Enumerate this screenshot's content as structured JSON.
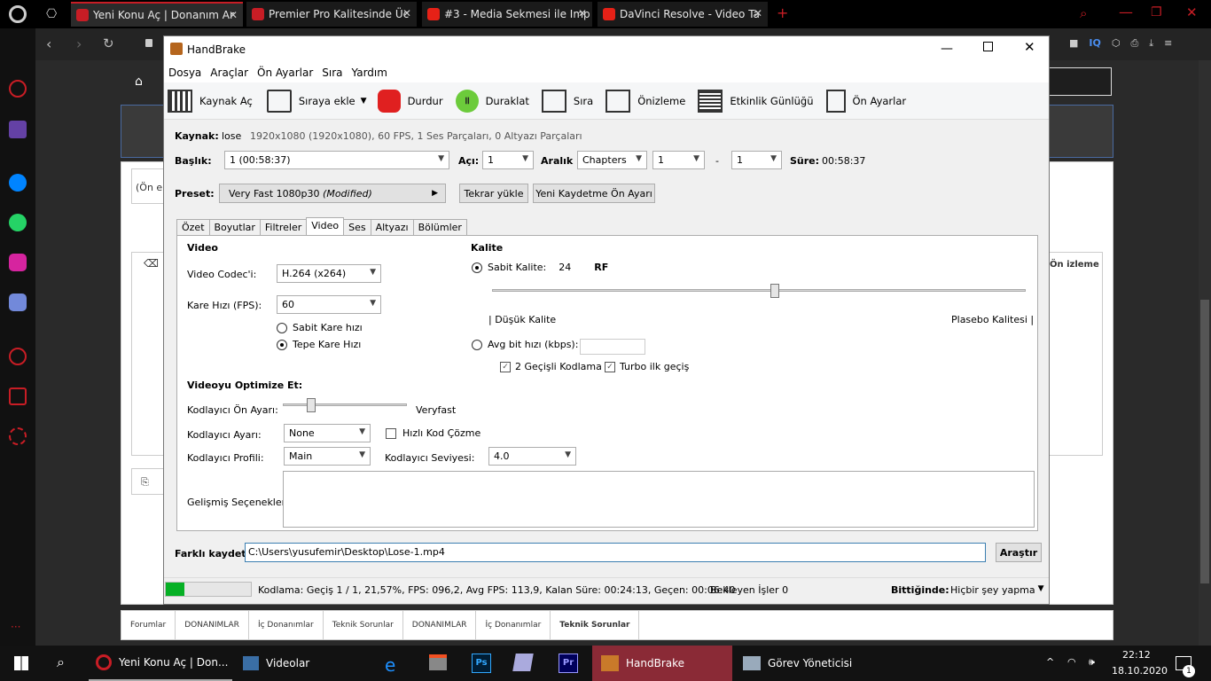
{
  "browser": {
    "tabs": [
      {
        "label": "Yeni Konu Aç | Donanım Ar",
        "active": true
      },
      {
        "label": "Premier Pro Kalitesinde Üc",
        "active": false
      },
      {
        "label": "#3 - Media Sekmesi ile Imp",
        "active": false
      },
      {
        "label": "DaVinci Resolve - Video Ta",
        "active": false
      }
    ]
  },
  "site": {
    "filter_text": "(Ön el",
    "preview_label": "Ön izleme",
    "breadcrumb": [
      "Forumlar",
      "DONANIMLAR",
      "İç Donanımlar",
      "Teknik Sorunlar",
      "DONANIMLAR",
      "İç Donanımlar",
      "Teknik Sorunlar"
    ]
  },
  "app": {
    "title": "HandBrake",
    "menu": [
      "Dosya",
      "Araçlar",
      "Ön Ayarlar",
      "Sıra",
      "Yardım"
    ],
    "toolbar": {
      "source": "Kaynak Aç",
      "add_queue": "Sıraya ekle",
      "stop": "Durdur",
      "pause": "Duraklat",
      "queue": "Sıra",
      "preview": "Önizleme",
      "activity": "Etkinlik Günlüğü",
      "presets": "Ön Ayarlar"
    },
    "source": {
      "label": "Kaynak:",
      "name": "lose",
      "info": "1920x1080 (1920x1080), 60 FPS, 1 Ses Parçaları, 0 Altyazı Parçaları"
    },
    "title_row": {
      "label": "Başlık:",
      "value": "1 (00:58:37)",
      "angle_label": "Açı:",
      "angle": "1",
      "range_label": "Aralık",
      "range_type": "Chapters",
      "range_from": "1",
      "dash": "-",
      "range_to": "1",
      "duration_label": "Süre:",
      "duration": "00:58:37"
    },
    "preset": {
      "label": "Preset:",
      "value": "Very Fast 1080p30",
      "modified": "(Modified)",
      "reload": "Tekrar yükle",
      "save_new": "Yeni Kaydetme Ön Ayarı"
    },
    "tabs": [
      "Özet",
      "Boyutlar",
      "Filtreler",
      "Video",
      "Ses",
      "Altyazı",
      "Bölümler"
    ],
    "video": {
      "section": "Video",
      "codec_label": "Video Codec'i:",
      "codec": "H.264 (x264)",
      "fps_label": "Kare Hızı (FPS):",
      "fps": "60",
      "cfr": "Sabit Kare hızı",
      "pfr": "Tepe Kare Hızı",
      "optimize_label": "Videoyu Optimize Et:",
      "preset_label": "Kodlayıcı Ön Ayarı:",
      "preset_value": "Veryfast",
      "tune_label": "Kodlayıcı Ayarı:",
      "tune": "None",
      "fastdecode": "Hızlı Kod Çözme",
      "profile_label": "Kodlayıcı Profili:",
      "profile": "Main",
      "level_label": "Kodlayıcı Seviyesi:",
      "level": "4.0",
      "advanced_label": "Gelişmiş Seçenekler:"
    },
    "quality": {
      "section": "Kalite",
      "cq_label": "Sabit Kalite:",
      "cq_value": "24",
      "rf": "RF",
      "cq_fraction": 0.53,
      "low": "| Düşük Kalite",
      "high": "Plasebo Kalitesi |",
      "abr_label": "Avg bit hızı (kbps):",
      "twopass": "2 Geçişli Kodlama",
      "turbo": "Turbo ilk geçiş"
    },
    "save": {
      "label": "Farklı kaydet:",
      "path": "C:\\Users\\yusufemir\\Desktop\\Lose-1.mp4",
      "browse": "Araştır"
    },
    "status": {
      "progress": 0.2157,
      "text": "Kodlama: Geçiş 1 / 1,  21,57%, FPS: 096,2,  Avg FPS: 113,9,  Kalan Süre: 00:24:13,  Geçen: 00:06:40",
      "pending": "Bekleyen İşler 0",
      "when_done_label": "Bittiğinde:",
      "when_done": "Hiçbir şey yapma"
    }
  },
  "taskbar": {
    "items": [
      "Yeni Konu Aç | Don...",
      "Videolar",
      "HandBrake",
      "Görev Yöneticisi"
    ],
    "time": "22:12",
    "date": "18.10.2020",
    "notif": "1"
  }
}
